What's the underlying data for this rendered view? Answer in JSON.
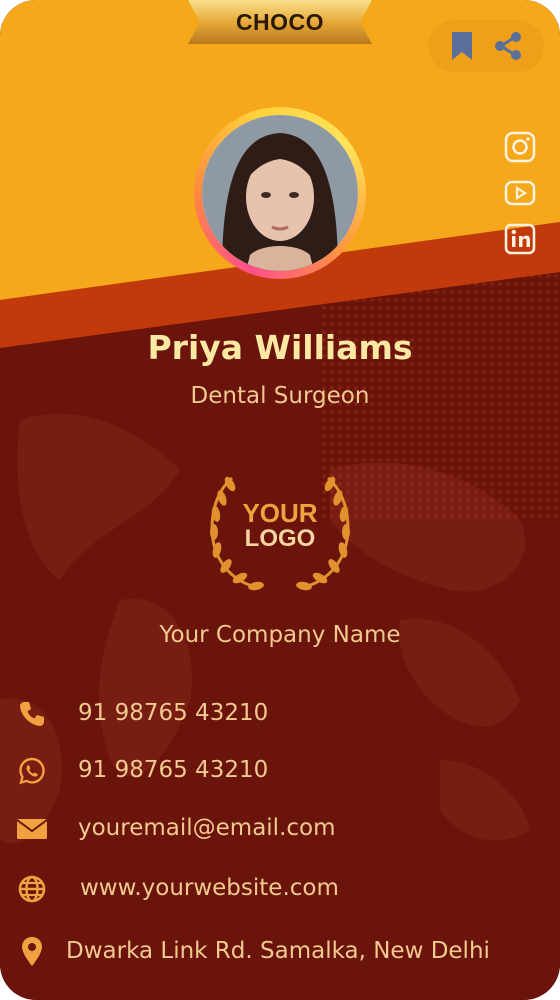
{
  "badge": {
    "label": "CHOCO"
  },
  "actions": {
    "bookmark_icon": "bookmark-icon",
    "share_icon": "share-icon"
  },
  "social": [
    {
      "name": "instagram",
      "icon": "instagram-icon"
    },
    {
      "name": "youtube",
      "icon": "youtube-icon"
    },
    {
      "name": "linkedin",
      "icon": "linkedin-icon"
    }
  ],
  "profile": {
    "name": "Priya Williams",
    "title": "Dental Surgeon"
  },
  "logo": {
    "line1": "YOUR",
    "line2": "LOGO"
  },
  "company": "Your Company Name",
  "contacts": [
    {
      "icon": "phone-icon",
      "text": "91 98765 43210"
    },
    {
      "icon": "whatsapp-icon",
      "text": "91 98765 43210"
    },
    {
      "icon": "email-icon",
      "text": "youremail@email.com"
    },
    {
      "icon": "globe-icon",
      "text": "www.yourwebsite.com"
    },
    {
      "icon": "location-pin-icon",
      "text": "Dwarka Link Rd. Samalka, New Delhi"
    }
  ],
  "colors": {
    "top": "#f5a81c",
    "band": "#c23a0c",
    "body": "#6a140b",
    "accent": "#f0a240",
    "name_text": "#fbe9a3",
    "body_text": "#f2c98f"
  }
}
